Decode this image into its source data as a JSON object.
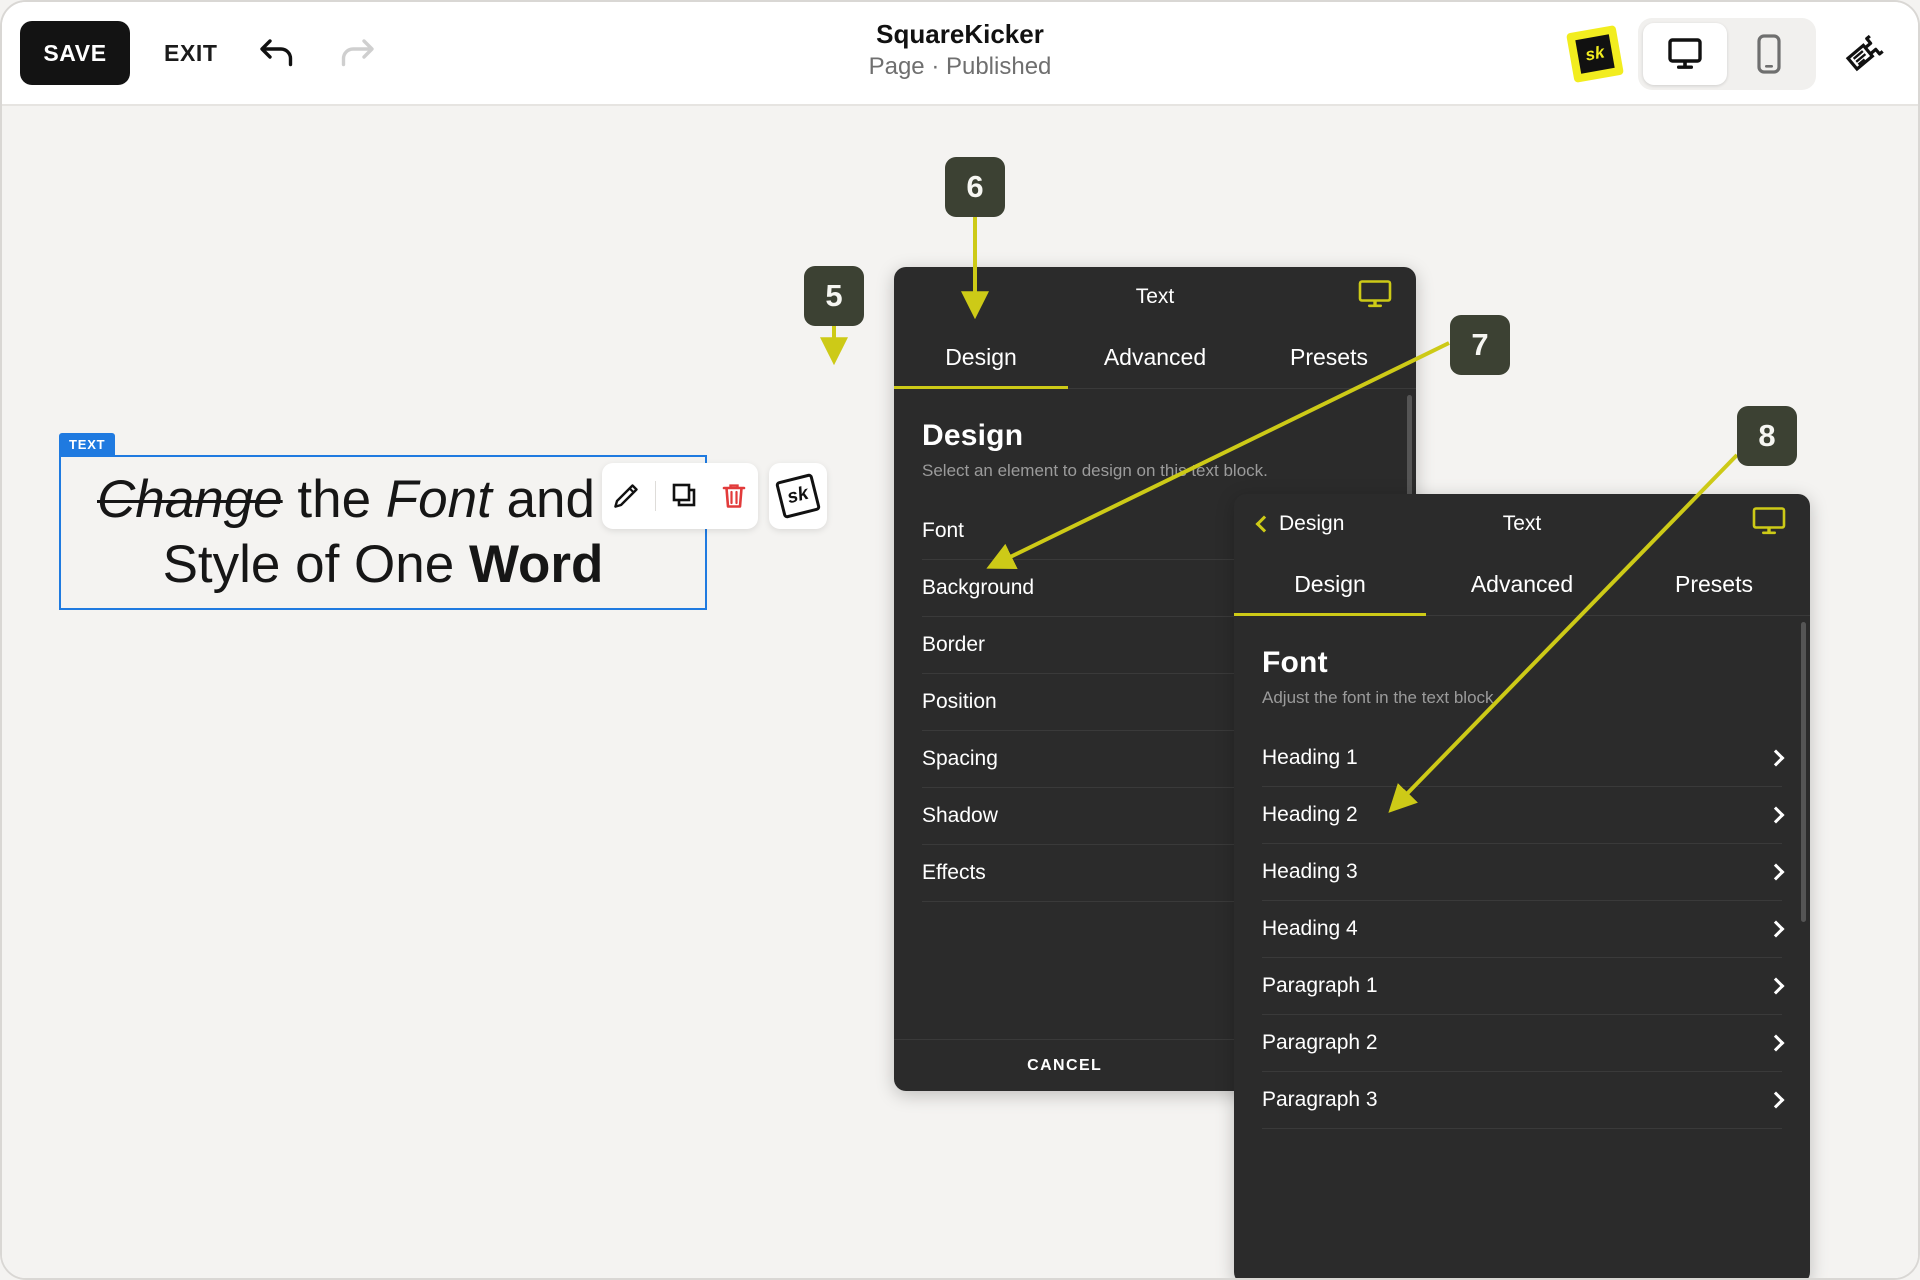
{
  "topbar": {
    "save_label": "SAVE",
    "exit_label": "EXIT",
    "undo_icon": "undo-icon",
    "redo_icon": "redo-icon",
    "title": "SquareKicker",
    "subtitle": "Page · Published",
    "logo_text": "sk",
    "devices": [
      {
        "name": "desktop",
        "icon": "desktop-icon",
        "active": true
      },
      {
        "name": "mobile",
        "icon": "mobile-icon",
        "active": false
      }
    ],
    "brush_icon": "paintbrush-icon"
  },
  "canvas": {
    "text_block": {
      "tag_label": "TEXT",
      "line1": {
        "word_strike": "Change",
        "rest": " the ",
        "word_italic": "Font",
        "tail": " and"
      },
      "line2": {
        "lead": "Style of One ",
        "word_bold": "Word"
      }
    },
    "element_toolbar": {
      "edit_icon": "pencil-icon",
      "duplicate_icon": "duplicate-icon",
      "delete_icon": "trash-icon",
      "sk_icon": "sk-badge-icon",
      "sk_label": "sk"
    }
  },
  "panel_design": {
    "window_title": "Text",
    "monitor_icon": "monitor-icon",
    "tabs": [
      {
        "label": "Design",
        "active": true
      },
      {
        "label": "Advanced",
        "active": false
      },
      {
        "label": "Presets",
        "active": false
      }
    ],
    "heading": "Design",
    "description": "Select an element to design on this text block.",
    "options": [
      "Font",
      "Background",
      "Border",
      "Position",
      "Spacing",
      "Shadow",
      "Effects"
    ],
    "cancel_label": "CANCEL"
  },
  "panel_font": {
    "back_label": "Design",
    "back_icon": "chevron-left-icon",
    "window_title": "Text",
    "monitor_icon": "monitor-icon",
    "tabs": [
      {
        "label": "Design",
        "active": true
      },
      {
        "label": "Advanced",
        "active": false
      },
      {
        "label": "Presets",
        "active": false
      }
    ],
    "heading": "Font",
    "description": "Adjust the font in the text block.",
    "items": [
      "Heading 1",
      "Heading 2",
      "Heading 3",
      "Heading 4",
      "Paragraph 1",
      "Paragraph 2",
      "Paragraph 3"
    ],
    "row_chevron_icon": "chevron-right-icon"
  },
  "annotations": {
    "badges": [
      {
        "number": "5"
      },
      {
        "number": "6"
      },
      {
        "number": "7"
      },
      {
        "number": "8"
      }
    ],
    "arrow_color": "#cdca17"
  },
  "colors": {
    "accent_yellow": "#cdca17",
    "logo_yellow": "#f2ed1f",
    "selection_blue": "#1f7ae0",
    "panel_bg": "#2b2b2b",
    "badge_bg": "#3c4133",
    "danger_red": "#e23b3b",
    "canvas_bg": "#f4f3f1"
  }
}
